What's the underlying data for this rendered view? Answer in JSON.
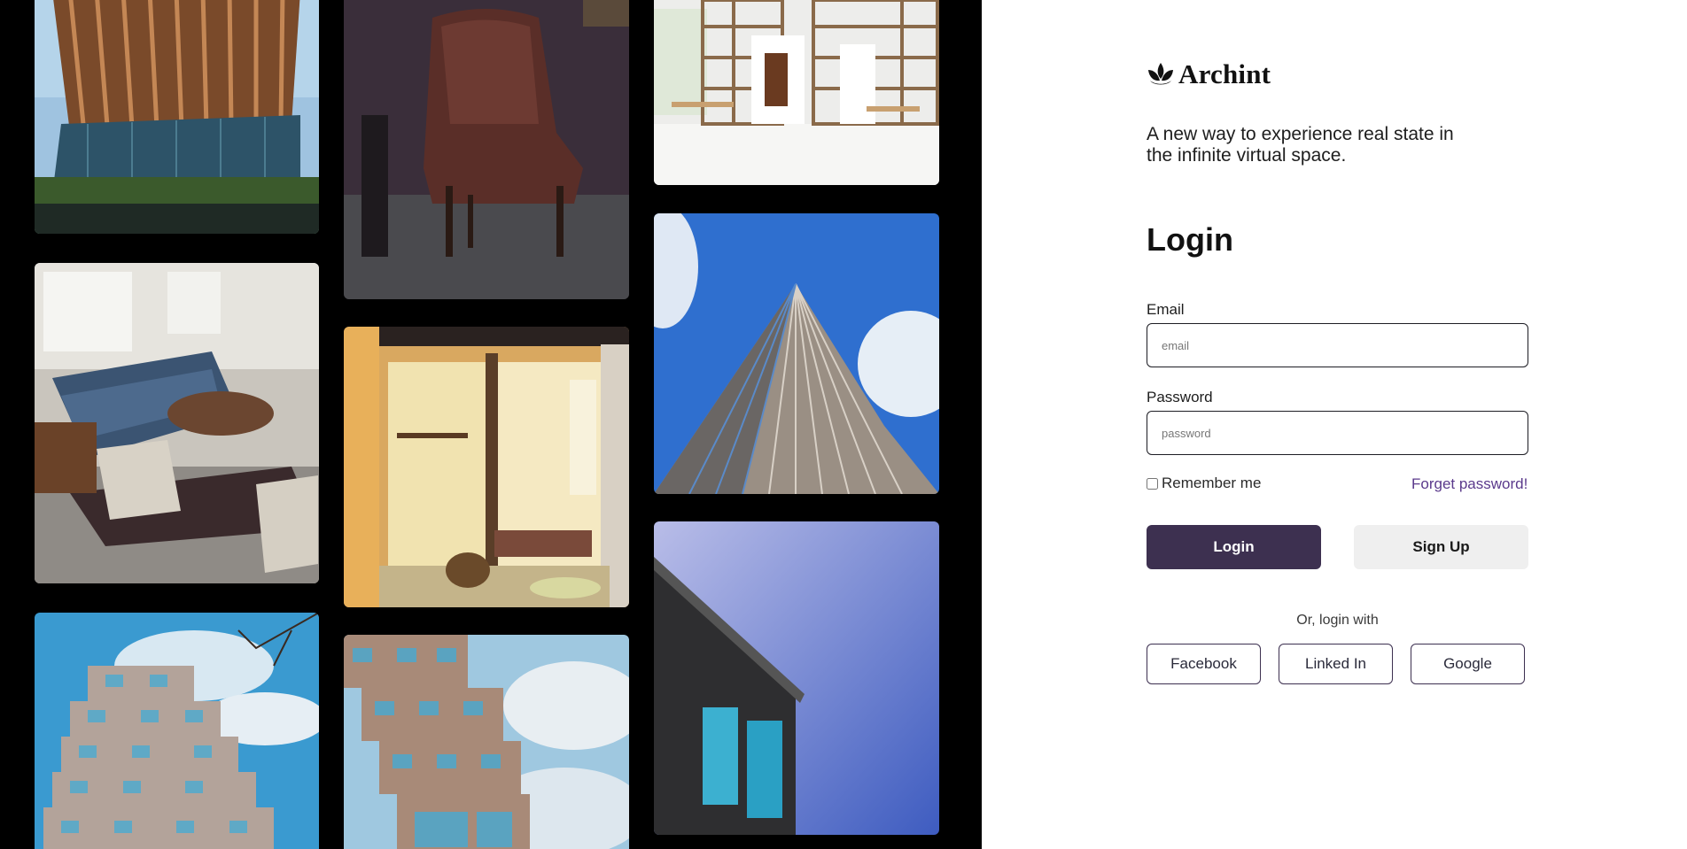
{
  "brand": {
    "name": "Archint",
    "icon": "lotus-icon"
  },
  "tagline": "A new way to experience real state in the infinite virtual space.",
  "login": {
    "title": "Login",
    "email_label": "Email",
    "email_placeholder": "email",
    "password_label": "Password",
    "password_placeholder": "password",
    "remember_label": "Remember me",
    "forgot_label": "Forget password!",
    "login_button": "Login",
    "signup_button": "Sign Up",
    "or_text": "Or, login with",
    "social": [
      "Facebook",
      "Linked In",
      "Google"
    ]
  },
  "colors": {
    "primary": "#3d3050",
    "link": "#5b3a8c",
    "gallery_bg": "#000000"
  }
}
